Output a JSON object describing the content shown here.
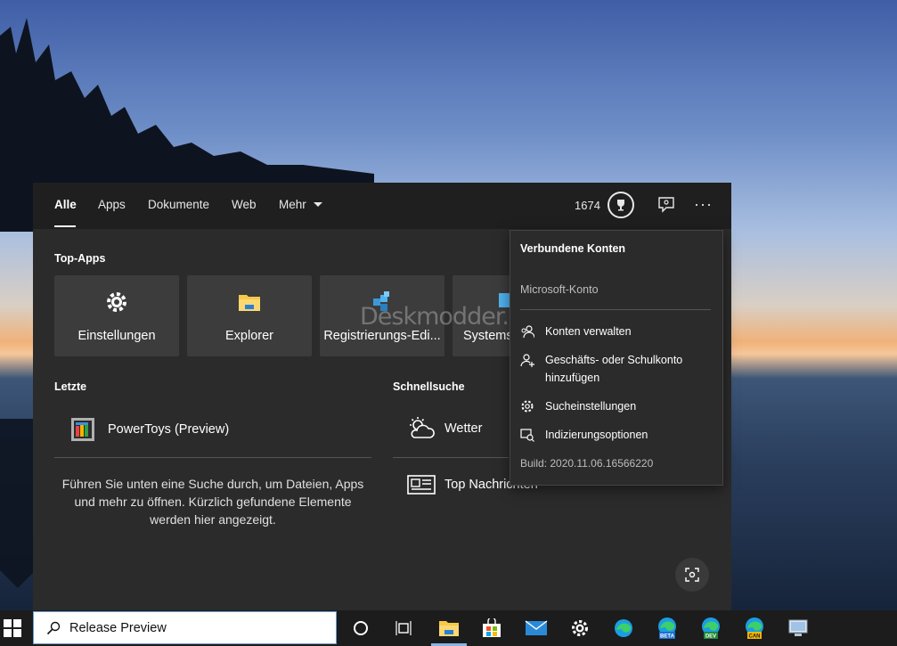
{
  "tabs": [
    {
      "label": "Alle"
    },
    {
      "label": "Apps"
    },
    {
      "label": "Dokumente"
    },
    {
      "label": "Web"
    },
    {
      "label": "Mehr"
    }
  ],
  "header": {
    "points": "1674"
  },
  "top_apps": {
    "title": "Top-Apps",
    "tiles": [
      {
        "label": "Einstellungen",
        "icon": "gear-icon"
      },
      {
        "label": "Explorer",
        "icon": "folder-icon"
      },
      {
        "label": "Registrierungs-Edi...",
        "icon": "registry-icon"
      },
      {
        "label": "Systems",
        "icon": "system-icon"
      }
    ]
  },
  "recent": {
    "title": "Letzte",
    "items": [
      {
        "label": "PowerToys (Preview)",
        "icon": "powertoys-icon"
      }
    ],
    "hint": "Führen Sie unten eine Suche durch, um Dateien, Apps und mehr zu öffnen. Kürzlich gefundene Elemente werden hier angezeigt."
  },
  "quick_search": {
    "title": "Schnellsuche",
    "items": [
      {
        "label": "Wetter",
        "icon": "weather-icon"
      },
      {
        "label": "Top Nachrichten",
        "icon": "news-icon"
      }
    ]
  },
  "dropdown": {
    "title": "Verbundene Konten",
    "account": "Microsoft-Konto",
    "items": [
      {
        "label": "Konten verwalten",
        "icon": "accounts-icon"
      },
      {
        "label": "Geschäfts- oder Schulkonto",
        "label2": "hinzufügen",
        "icon": "add-person-icon"
      },
      {
        "label": "Sucheinstellungen",
        "icon": "gear-icon"
      },
      {
        "label": "Indizierungsoptionen",
        "icon": "indexing-icon"
      }
    ],
    "build": "Build: 2020.11.06.16566220"
  },
  "watermark": "Deskmodder.de",
  "taskbar": {
    "search_value": "Release Preview",
    "icons": [
      "cortana-icon",
      "task-view-icon",
      "explorer-icon",
      "store-icon",
      "mail-icon",
      "settings-icon",
      "edge-icon",
      "edge-beta-icon",
      "edge-dev-icon",
      "edge-canary-icon",
      "app-icon"
    ],
    "badges": {
      "beta": "BETA",
      "dev": "DEV",
      "can": "CAN"
    }
  },
  "colors": {
    "panel": "#2b2b2b",
    "topbar": "#1f1f1f",
    "tile": "#3c3c3c",
    "accent": "#0078d7"
  }
}
